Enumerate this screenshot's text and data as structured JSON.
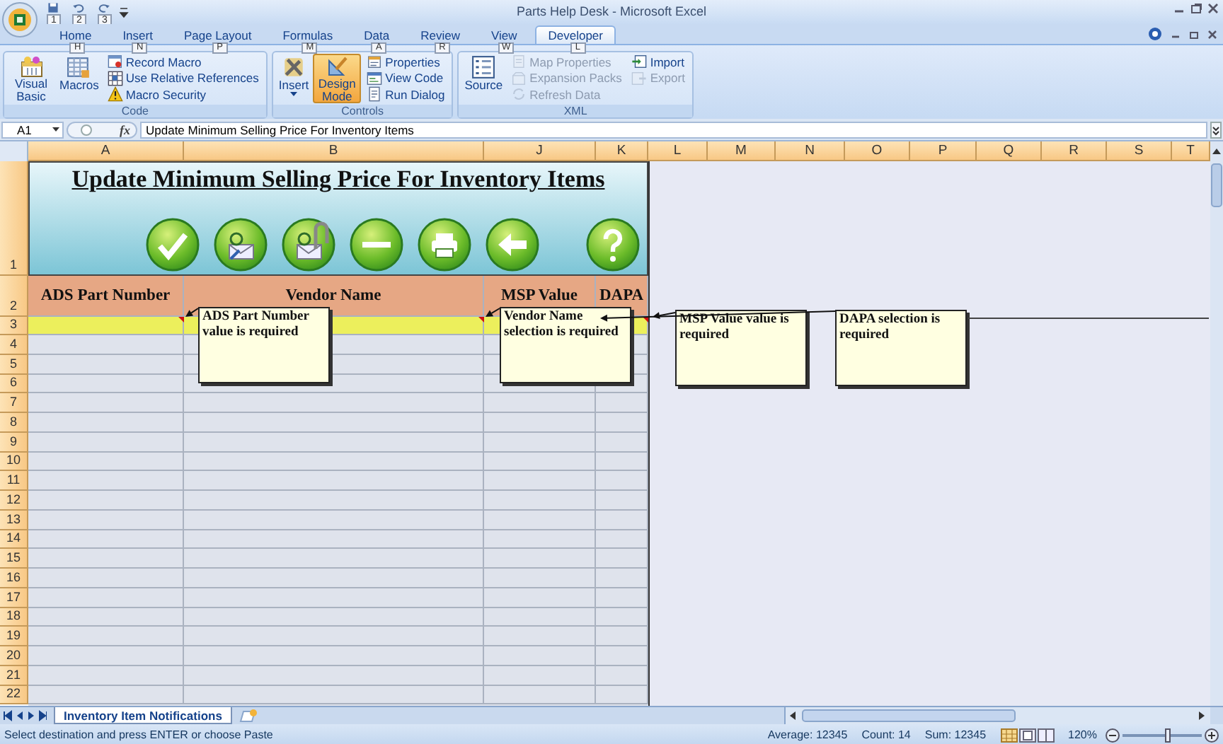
{
  "window": {
    "title": "Parts Help Desk - Microsoft Excel"
  },
  "quick_access": [
    {
      "keytip": "1"
    },
    {
      "keytip": "2"
    },
    {
      "keytip": "3"
    }
  ],
  "ribbon": {
    "tabs": [
      {
        "label": "Home",
        "keytip": "H",
        "selected": false
      },
      {
        "label": "Insert",
        "keytip": "N",
        "selected": false
      },
      {
        "label": "Page Layout",
        "keytip": "P",
        "selected": false
      },
      {
        "label": "Formulas",
        "keytip": "M",
        "selected": false
      },
      {
        "label": "Data",
        "keytip": "A",
        "selected": false
      },
      {
        "label": "Review",
        "keytip": "R",
        "selected": false
      },
      {
        "label": "View",
        "keytip": "W",
        "selected": false
      },
      {
        "label": "Developer",
        "keytip": "L",
        "selected": true
      }
    ],
    "groups": [
      {
        "label": "Code",
        "items": [
          {
            "label": "Visual Basic",
            "kind": "large",
            "on": false,
            "disabled": false,
            "dropdown": false
          },
          {
            "label": "Macros",
            "kind": "large",
            "on": false,
            "disabled": false,
            "dropdown": false
          },
          {
            "label": "Record Macro",
            "kind": "small",
            "on": false,
            "disabled": false,
            "dropdown": false
          },
          {
            "label": "Use Relative References",
            "kind": "small",
            "on": false,
            "disabled": false,
            "dropdown": false
          },
          {
            "label": "Macro Security",
            "kind": "small",
            "on": false,
            "disabled": false,
            "dropdown": false
          }
        ]
      },
      {
        "label": "Controls",
        "items": [
          {
            "label": "Insert",
            "kind": "large",
            "on": false,
            "disabled": false,
            "dropdown": true
          },
          {
            "label": "Design Mode",
            "kind": "large",
            "on": true,
            "disabled": false,
            "dropdown": false
          },
          {
            "label": "Properties",
            "kind": "small",
            "on": false,
            "disabled": false,
            "dropdown": false
          },
          {
            "label": "View Code",
            "kind": "small",
            "on": false,
            "disabled": false,
            "dropdown": false
          },
          {
            "label": "Run Dialog",
            "kind": "small",
            "on": false,
            "disabled": false,
            "dropdown": false
          }
        ]
      },
      {
        "label": "XML",
        "items": [
          {
            "label": "Source",
            "kind": "large",
            "on": false,
            "disabled": false,
            "dropdown": false
          },
          {
            "label": "Map Properties",
            "kind": "small",
            "on": false,
            "disabled": true,
            "dropdown": false
          },
          {
            "label": "Expansion Packs",
            "kind": "small",
            "on": false,
            "disabled": true,
            "dropdown": false
          },
          {
            "label": "Refresh Data",
            "kind": "small",
            "on": false,
            "disabled": true,
            "dropdown": false
          },
          {
            "label": "Import",
            "kind": "small",
            "on": false,
            "disabled": false,
            "dropdown": false
          },
          {
            "label": "Export",
            "kind": "small",
            "on": false,
            "disabled": true,
            "dropdown": false
          }
        ]
      }
    ]
  },
  "formula_bar": {
    "name_box": "A1",
    "function_label": "fx",
    "content": "Update Minimum Selling Price For Inventory Items"
  },
  "columns": [
    "A",
    "B",
    "J",
    "K",
    "L",
    "M",
    "N",
    "O",
    "P",
    "Q",
    "R",
    "S",
    "T"
  ],
  "rows": [
    "1",
    "2",
    "3",
    "4",
    "5",
    "6",
    "7",
    "8",
    "9",
    "10",
    "11",
    "12",
    "13",
    "14",
    "15",
    "16",
    "17",
    "18",
    "19",
    "20",
    "21",
    "22"
  ],
  "sheet": {
    "title": "Update Minimum Selling Price For Inventory Items",
    "headers": [
      "ADS Part Number",
      "Vendor Name",
      "MSP Value",
      "DAPA"
    ]
  },
  "comments": [
    {
      "text": "ADS Part Number value is required"
    },
    {
      "text": "Vendor Name selection is required"
    },
    {
      "text": "MSP Value value is required"
    },
    {
      "text": "DAPA selection is required"
    }
  ],
  "sheet_tabs": [
    {
      "label": "Inventory Item Notifications",
      "selected": true
    }
  ],
  "status_bar": {
    "message": "Select destination and press ENTER or choose Paste",
    "average": "Average: 12345",
    "count": "Count: 14",
    "sum": "Sum: 12345",
    "zoom": "120%",
    "zoom_slider": {
      "level": 0.58
    }
  }
}
